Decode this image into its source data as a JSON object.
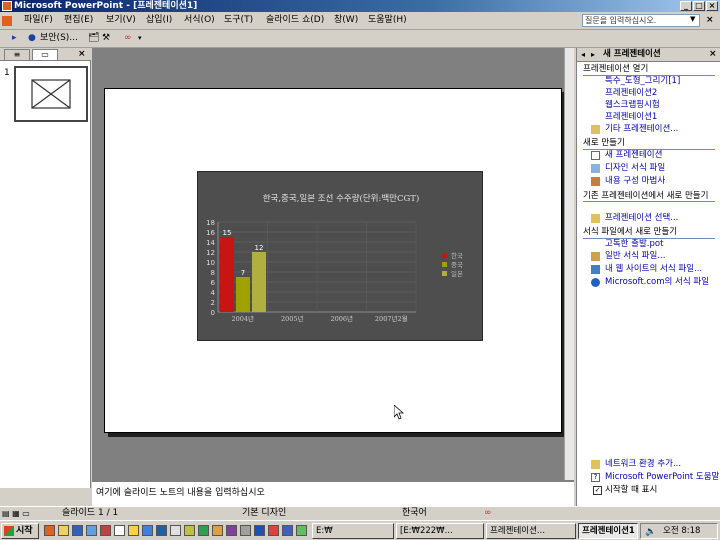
{
  "window": {
    "title": "Microsoft PowerPoint - [프레젠테이션1]"
  },
  "menu": {
    "items": [
      "파일(F)",
      "편집(E)",
      "보기(V)",
      "삽입(I)",
      "서식(O)",
      "도구(T)",
      "슬라이드 쇼(D)",
      "창(W)",
      "도움말(H)"
    ],
    "help_placeholder": "질문을 입력하십시오."
  },
  "toolbar": {
    "security_label": "보안(S)..."
  },
  "outline": {
    "slide_number": "1"
  },
  "chart_data": {
    "type": "bar",
    "title": "한국,중국,일본 조선 수주량(단위:백만CGT)",
    "categories": [
      "2004년",
      "2005년",
      "2006년",
      "2007년2월"
    ],
    "series": [
      {
        "name": "한국",
        "values": [
          15,
          null,
          null,
          null
        ],
        "color": "#c81414"
      },
      {
        "name": "중국",
        "values": [
          7,
          null,
          null,
          null
        ],
        "color": "#a0a000"
      },
      {
        "name": "일본",
        "values": [
          12,
          null,
          null,
          null
        ],
        "color": "#b0b040"
      }
    ],
    "data_labels": [
      "15",
      "7",
      "12"
    ],
    "ylim": [
      0,
      18
    ],
    "yticks": [
      "0",
      "2",
      "4",
      "6",
      "8",
      "10",
      "12",
      "14",
      "16",
      "18"
    ],
    "legend": "right",
    "grid": true
  },
  "notes": {
    "placeholder": "여기에 슬라이드 노트의 내용을 입력하십시오"
  },
  "taskpane": {
    "title": "새 프레젠테이션",
    "sec_open": "프레젠테이션 열기",
    "recent": [
      "특수_도형_그리기[1]",
      "프레젠테이션2",
      "웹스크랩핑시험",
      "프레젠테이션1"
    ],
    "more": "기타 프레젠테이션...",
    "sec_new": "새로 만들기",
    "new_items": [
      "새 프레젠테이션",
      "디자인 서식 파일",
      "내용 구성 마법사"
    ],
    "sec_existing": "기존 프레젠테이션에서 새로 만들기",
    "existing_item": "프레젠테이션 선택...",
    "sec_template": "서식 파일에서 새로 만들기",
    "template_items": [
      "고독한 출발.pot",
      "일반 서식 파일...",
      "내 웹 사이트의 서식 파일...",
      "Microsoft.com의 서식 파일"
    ],
    "bottom_items": [
      "네트워크 환경 추가...",
      "Microsoft PowerPoint 도움말"
    ],
    "startup_label": "시작할 때 표시"
  },
  "status": {
    "slide": "슬라이드 1 / 1",
    "design": "기본 디자인",
    "language": "한국어"
  },
  "taskbar": {
    "start": "시작",
    "tasks": [
      "E:₩",
      "[E:₩222₩...",
      "프레젠테이션...",
      "프레젠테이션1"
    ],
    "clock": "오전 8:18"
  }
}
